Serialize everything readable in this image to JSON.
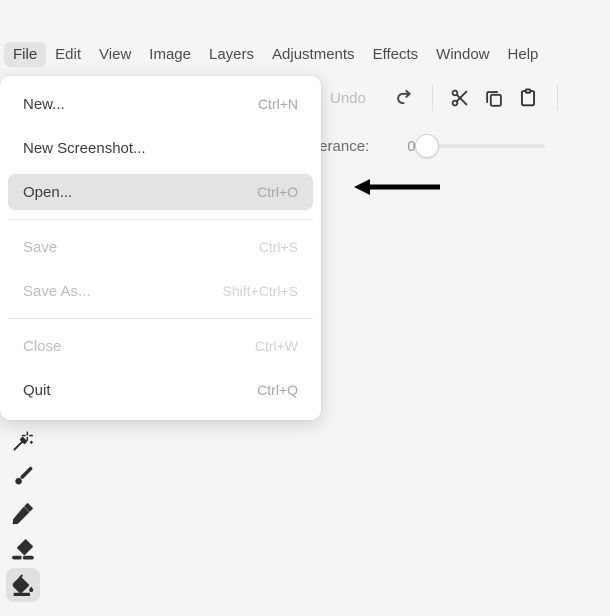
{
  "app": {
    "background_color": "#f5f5f5",
    "accent_highlight": "#e3e3e3"
  },
  "menubar": {
    "items": [
      {
        "label": "File",
        "active": true
      },
      {
        "label": "Edit",
        "active": false
      },
      {
        "label": "View",
        "active": false
      },
      {
        "label": "Image",
        "active": false
      },
      {
        "label": "Layers",
        "active": false
      },
      {
        "label": "Adjustments",
        "active": false
      },
      {
        "label": "Effects",
        "active": false
      },
      {
        "label": "Window",
        "active": false
      },
      {
        "label": "Help",
        "active": false
      }
    ]
  },
  "file_menu": {
    "open": true,
    "items": [
      {
        "label": "New...",
        "accel": "Ctrl+N",
        "disabled": false,
        "highlight": false
      },
      {
        "label": "New Screenshot...",
        "accel": "",
        "disabled": false,
        "highlight": false
      },
      {
        "label": "Open...",
        "accel": "Ctrl+O",
        "disabled": false,
        "highlight": true
      },
      {
        "label": "Save",
        "accel": "Ctrl+S",
        "disabled": true,
        "highlight": false
      },
      {
        "label": "Save As...",
        "accel": "Shift+Ctrl+S",
        "disabled": true,
        "highlight": false
      },
      {
        "label": "Close",
        "accel": "Ctrl+W",
        "disabled": true,
        "highlight": false
      },
      {
        "label": "Quit",
        "accel": "Ctrl+Q",
        "disabled": false,
        "highlight": false
      }
    ]
  },
  "toolbar": {
    "undo_label": "Undo",
    "undo_disabled": true,
    "buttons": [
      {
        "name": "redo-icon",
        "label": "Redo"
      },
      {
        "name": "cut-icon",
        "label": "Cut"
      },
      {
        "name": "copy-icon",
        "label": "Copy"
      },
      {
        "name": "paste-icon",
        "label": "Paste"
      }
    ]
  },
  "options": {
    "tolerance_label": "Tolerance:",
    "tolerance_value": "0",
    "tolerance_min": 0,
    "tolerance_max": 100
  },
  "tools": {
    "selected": "paint-bucket",
    "items": [
      {
        "id": "magic-wand",
        "label": "Magic Wand"
      },
      {
        "id": "paintbrush",
        "label": "Paintbrush"
      },
      {
        "id": "pencil",
        "label": "Pencil"
      },
      {
        "id": "eraser",
        "label": "Eraser"
      },
      {
        "id": "paint-bucket",
        "label": "Paint Bucket"
      }
    ]
  },
  "annotation": {
    "arrow_direction": "left",
    "arrow_color": "#000000"
  }
}
